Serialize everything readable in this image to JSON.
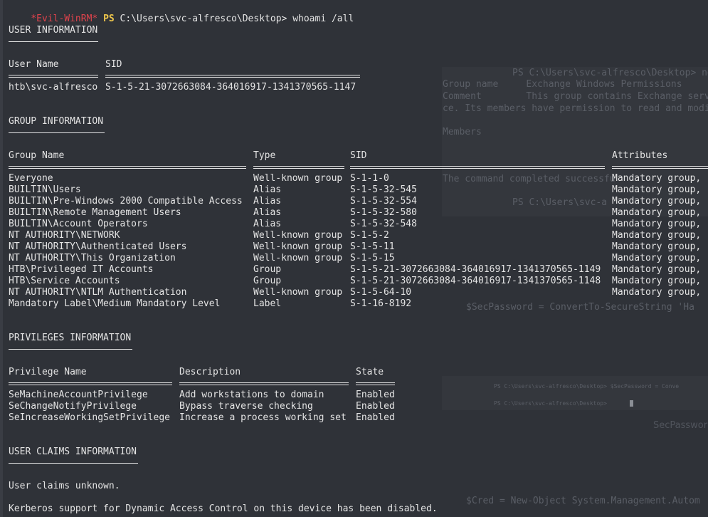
{
  "prompt": {
    "host": "*Evil-WinRM*",
    "shell": "PS",
    "path": "C:\\Users\\svc-alfresco\\Desktop>",
    "command": "whoami /all"
  },
  "user_info": {
    "title": "USER INFORMATION",
    "col_user": "User Name",
    "col_sid": "SID",
    "user": "htb\\svc-alfresco",
    "sid": "S-1-5-21-3072663084-364016917-1341370565-1147"
  },
  "group_info": {
    "title": "GROUP INFORMATION",
    "columns": [
      "Group Name",
      "Type",
      "SID",
      "Attributes"
    ],
    "rows": [
      {
        "name": "Everyone",
        "type": "Well-known group",
        "sid": "S-1-1-0",
        "attr": "Mandatory group,"
      },
      {
        "name": "BUILTIN\\Users",
        "type": "Alias",
        "sid": "S-1-5-32-545",
        "attr": "Mandatory group,"
      },
      {
        "name": "BUILTIN\\Pre-Windows 2000 Compatible Access",
        "type": "Alias",
        "sid": "S-1-5-32-554",
        "attr": "Mandatory group,"
      },
      {
        "name": "BUILTIN\\Remote Management Users",
        "type": "Alias",
        "sid": "S-1-5-32-580",
        "attr": "Mandatory group,"
      },
      {
        "name": "BUILTIN\\Account Operators",
        "type": "Alias",
        "sid": "S-1-5-32-548",
        "attr": "Mandatory group,"
      },
      {
        "name": "NT AUTHORITY\\NETWORK",
        "type": "Well-known group",
        "sid": "S-1-5-2",
        "attr": "Mandatory group,"
      },
      {
        "name": "NT AUTHORITY\\Authenticated Users",
        "type": "Well-known group",
        "sid": "S-1-5-11",
        "attr": "Mandatory group,"
      },
      {
        "name": "NT AUTHORITY\\This Organization",
        "type": "Well-known group",
        "sid": "S-1-5-15",
        "attr": "Mandatory group,"
      },
      {
        "name": "HTB\\Privileged IT Accounts",
        "type": "Group",
        "sid": "S-1-5-21-3072663084-364016917-1341370565-1149",
        "attr": "Mandatory group,"
      },
      {
        "name": "HTB\\Service Accounts",
        "type": "Group",
        "sid": "S-1-5-21-3072663084-364016917-1341370565-1148",
        "attr": "Mandatory group,"
      },
      {
        "name": "NT AUTHORITY\\NTLM Authentication",
        "type": "Well-known group",
        "sid": "S-1-5-64-10",
        "attr": "Mandatory group,"
      },
      {
        "name": "Mandatory Label\\Medium Mandatory Level",
        "type": "Label",
        "sid": "S-1-16-8192",
        "attr": ""
      }
    ]
  },
  "privileges_info": {
    "title": "PRIVILEGES INFORMATION",
    "columns": [
      "Privilege Name",
      "Description",
      "State"
    ],
    "rows": [
      {
        "name": "SeMachineAccountPrivilege",
        "desc": "Add workstations to domain",
        "state": "Enabled"
      },
      {
        "name": "SeChangeNotifyPrivilege",
        "desc": "Bypass traverse checking",
        "state": "Enabled"
      },
      {
        "name": "SeIncreaseWorkingSetPrivilege",
        "desc": "Increase a process working set",
        "state": "Enabled"
      }
    ]
  },
  "claims_info": {
    "title": "USER CLAIMS INFORMATION",
    "claims": "User claims unknown.",
    "kerberos": "Kerberos support for Dynamic Access Control on this device has been disabled."
  },
  "background": {
    "line1": "PS C:\\Users\\svc-alfresco\\Desktop> ne",
    "line2": "Group name     Exchange Windows Permissions",
    "line3": "Comment        This group contains Exchange serv",
    "line4": "ce. Its members have permission to read and modi",
    "line5": "Members",
    "line6": "The command completed successfu",
    "line7": "PS C:\\Users\\svc-a",
    "line8": "$SecPassword = ConvertTo-SecureString 'Ha",
    "line9": "PS C:\\Users\\svc-alfresco\\Desktop> $SecPassword = Conve",
    "line10": "PS C:\\Users\\svc-alfresco\\Desktop> ",
    "line11": "SecPasswor",
    "line12": "$Cred = New-Object System.Management.Autom"
  },
  "colors": {
    "background": "#2f3238",
    "text": "#e4e4e4",
    "prompt_host": "#e0434c",
    "prompt_ps": "#f2c94c"
  }
}
